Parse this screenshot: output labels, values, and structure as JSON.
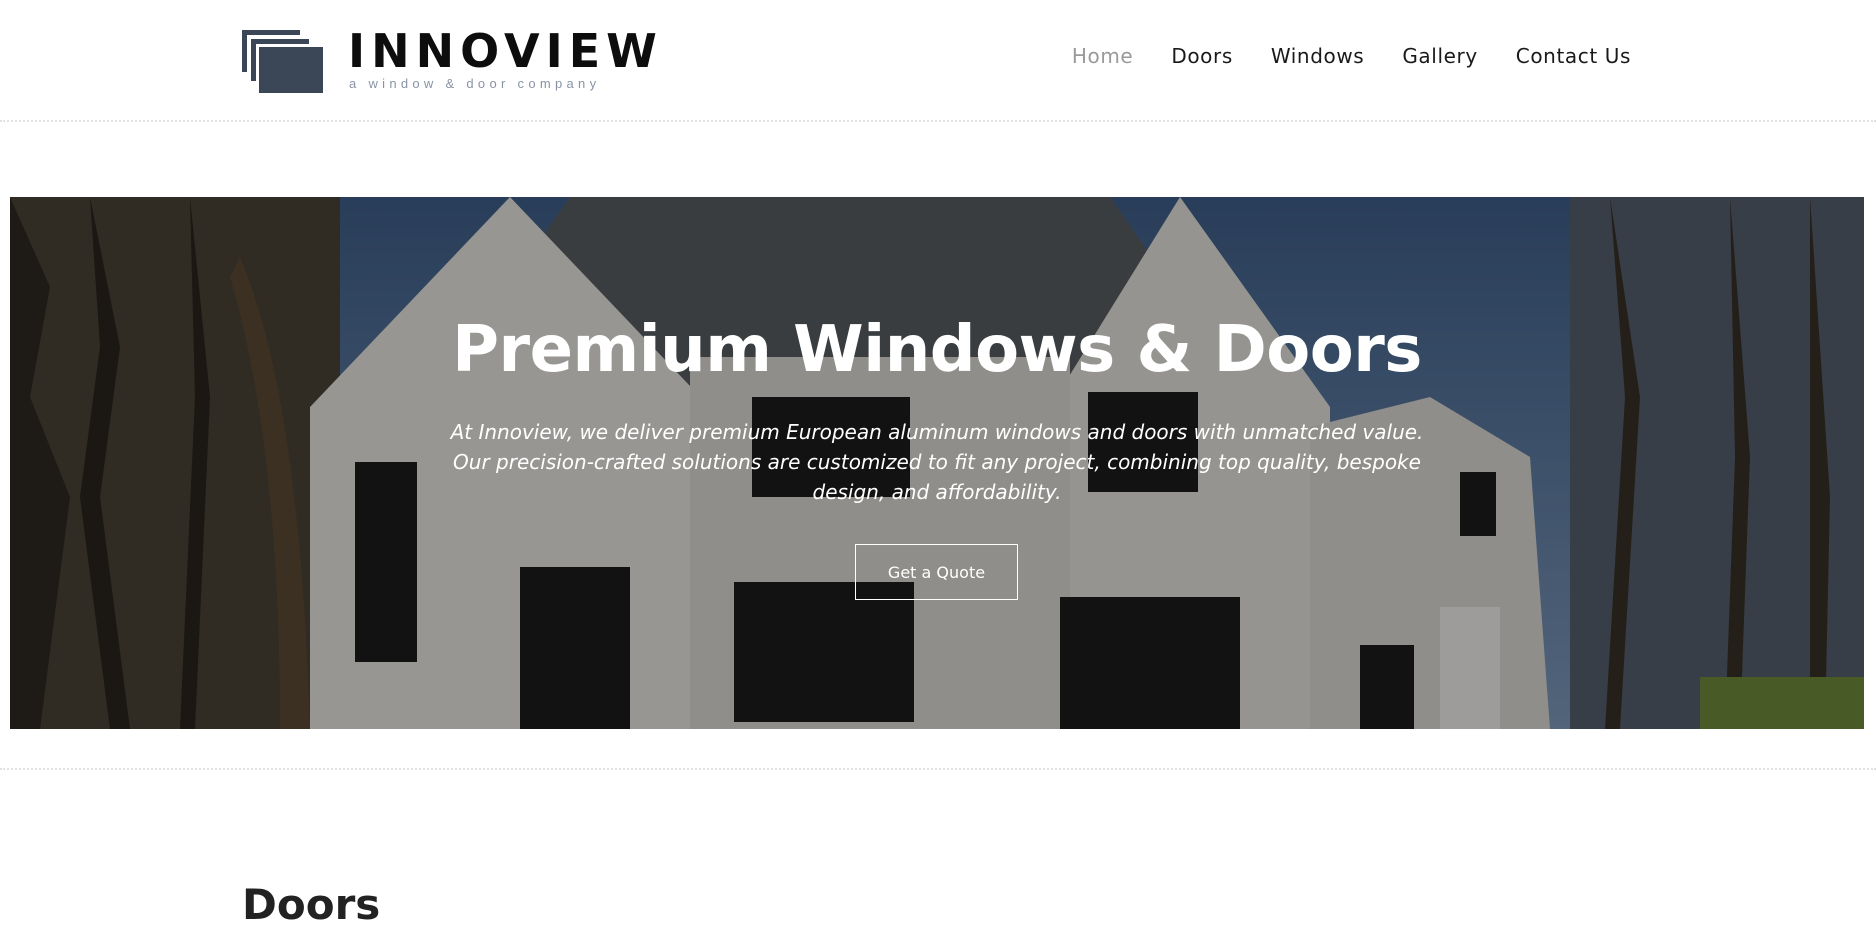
{
  "brand": {
    "name": "INNOVIEW",
    "tagline": "a window & door company",
    "logo_color": "#3b4657"
  },
  "nav": {
    "items": [
      {
        "label": "Home",
        "active": true
      },
      {
        "label": "Doors",
        "active": false
      },
      {
        "label": "Windows",
        "active": false
      },
      {
        "label": "Gallery",
        "active": false
      },
      {
        "label": "Contact Us",
        "active": false
      }
    ]
  },
  "hero": {
    "title": "Premium Windows & Doors",
    "text": "At Innoview, we deliver premium European aluminum windows and doors with unmatched value. Our precision-crafted solutions are customized to fit any project, combining top quality, bespoke design, and affordability.",
    "button_label": "Get a Quote",
    "image_subject": "white-brick-house-with-black-frame-windows"
  },
  "section": {
    "title": "Doors"
  }
}
